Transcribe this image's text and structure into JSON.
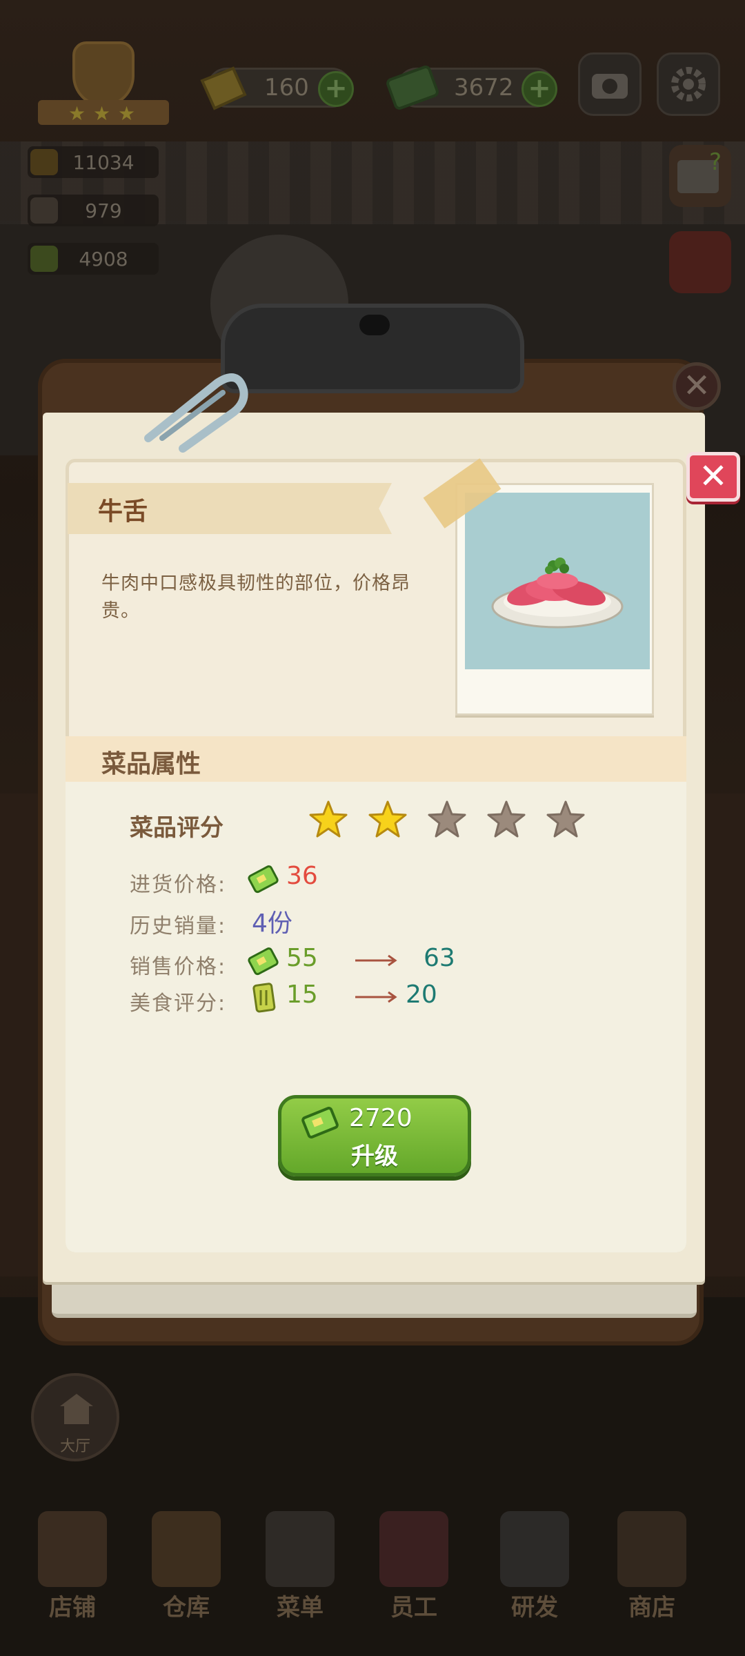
{
  "hud": {
    "diamond_amount": "160",
    "cash_amount": "3672",
    "stats": [
      "11034",
      "979",
      "4908"
    ]
  },
  "dialog": {
    "dish_name": "牛舌",
    "description": "牛肉中口感极具韧性的部位，价格昂贵。",
    "section_title": "菜品属性",
    "rating_label": "菜品评分",
    "rating": {
      "filled": 2,
      "total": 5
    },
    "attributes": [
      {
        "label": "进货价格:",
        "value": "36",
        "color": "#e34b3e"
      },
      {
        "label": "历史销量:",
        "value": "4份",
        "color": "#5f5fb3"
      },
      {
        "label": "销售价格:",
        "value": "55",
        "next": "63",
        "color": "#6a9d2a",
        "next_color": "#1d7a72"
      },
      {
        "label": "美食评分:",
        "value": "15",
        "next": "20",
        "color": "#6a9d2a",
        "next_color": "#1d7a72"
      }
    ],
    "upgrade": {
      "cost": "2720",
      "label": "升级"
    }
  },
  "nav": {
    "hall": "大厅",
    "tabs": [
      "店铺",
      "仓库",
      "菜单",
      "员工",
      "研发",
      "商店"
    ]
  },
  "colors": {
    "close_button": "#e0465a",
    "upgrade_button": "#7bbd37",
    "star_filled": "#f7d21b",
    "star_empty": "#9b8a7c"
  },
  "icons": [
    "medal-icon",
    "diamond-icon",
    "cash-icon",
    "camera-icon",
    "gear-icon",
    "guide-book-icon",
    "close-icon",
    "paperclip-icon",
    "star-icon",
    "arrow-right-icon",
    "food-coupon-icon"
  ]
}
